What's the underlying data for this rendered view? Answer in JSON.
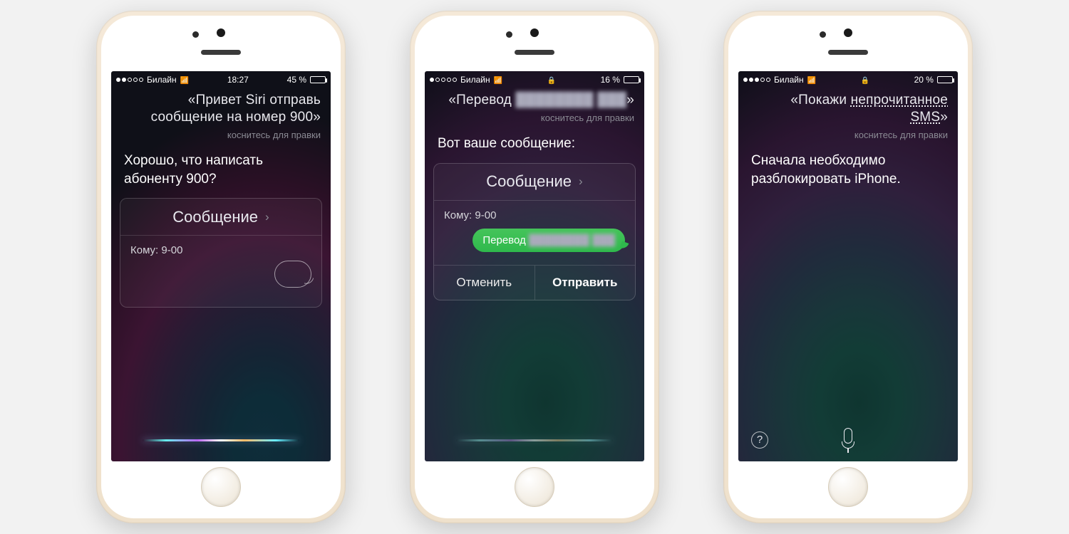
{
  "phones": [
    {
      "status": {
        "carrier": "Билайн",
        "time": "18:27",
        "battery_pct": "45 %",
        "signal_filled": 2,
        "has_lock": false
      },
      "query_l1": "«Привет Siri отправь",
      "query_l2": "сообщение на номер 900»",
      "tap_edit": "коснитесь для правки",
      "response_l1": "Хорошо, что написать",
      "response_l2": "абоненту 900?",
      "card_title": "Сообщение",
      "to_label": "Кому:",
      "to_value": "9-00"
    },
    {
      "status": {
        "carrier": "Билайн",
        "time": "",
        "battery_pct": "16 %",
        "signal_filled": 1,
        "has_lock": true
      },
      "query_l1_prefix": "«Перевод",
      "blurred_placeholder": "████████ ███",
      "query_trailing": "»",
      "tap_edit": "коснитесь для правки",
      "response_l1": "Вот ваше сообщение:",
      "card_title": "Сообщение",
      "to_label": "Кому:",
      "to_value": "9-00",
      "bubble_prefix": "Перевод",
      "cancel": "Отменить",
      "send": "Отправить"
    },
    {
      "status": {
        "carrier": "Билайн",
        "time": "",
        "battery_pct": "20 %",
        "signal_filled": 3,
        "has_lock": true
      },
      "query_l1_prefix": "«Покажи ",
      "query_l1_under": "непрочитанное",
      "query_l2_under": "SMS",
      "query_trailing": "»",
      "tap_edit": "коснитесь для правки",
      "response_l1": "Сначала необходимо",
      "response_l2": "разблокировать iPhone."
    }
  ]
}
